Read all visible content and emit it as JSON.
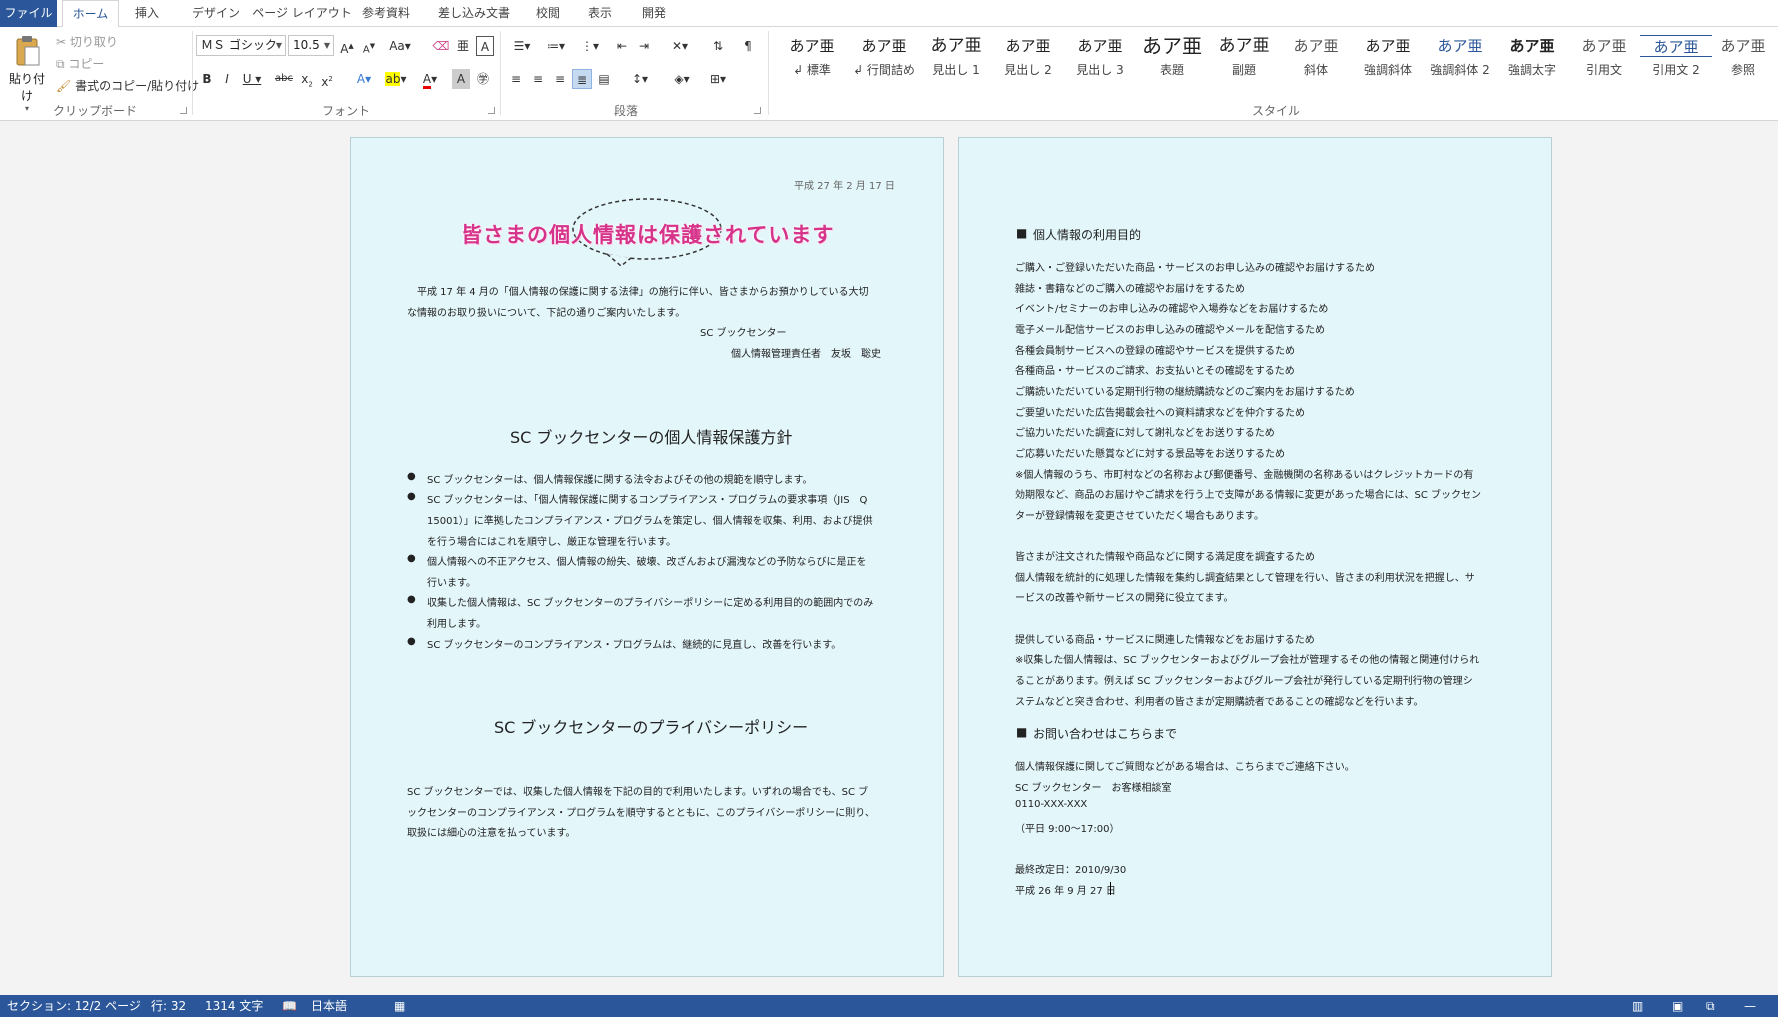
{
  "tabs": [
    "ファイル",
    "ホーム",
    "挿入",
    "デザイン",
    "ページ レイアウト",
    "参考資料",
    "差し込み文書",
    "校閲",
    "表示",
    "開発"
  ],
  "clipboard": {
    "paste": "貼り付け",
    "cut": "切り取り",
    "copy": "コピー",
    "format_painter": "書式のコピー/貼り付け",
    "label": "クリップボード"
  },
  "font": {
    "name": "ＭＳ ゴシック",
    "size": "10.5",
    "label": "フォント"
  },
  "paragraph": {
    "label": "段落"
  },
  "styles": {
    "label": "スタイル",
    "items": [
      {
        "sample": "あア亜",
        "name": "↲ 標準"
      },
      {
        "sample": "あア亜",
        "name": "↲ 行間詰め"
      },
      {
        "sample": "あア亜",
        "name": "見出し 1"
      },
      {
        "sample": "あア亜",
        "name": "見出し 2"
      },
      {
        "sample": "あア亜",
        "name": "見出し 3"
      },
      {
        "sample": "あア亜",
        "name": "表題"
      },
      {
        "sample": "あア亜",
        "name": "副題"
      },
      {
        "sample": "あア亜",
        "name": "斜体"
      },
      {
        "sample": "あア亜",
        "name": "強調斜体"
      },
      {
        "sample": "あア亜",
        "name": "強調斜体 2"
      },
      {
        "sample": "あア亜",
        "name": "強調太字"
      },
      {
        "sample": "あア亜",
        "name": "引用文"
      },
      {
        "sample": "あア亜",
        "name": "引用文 2"
      },
      {
        "sample": "あア亜",
        "name": "参照"
      }
    ]
  },
  "page1": {
    "date": "平成 27 年 2 月 17 日",
    "title": "皆さまの個人情報は保護されています",
    "intro": [
      "平成 17 年 4 月の「個人情報の保護に関する法律」の施行に伴い、皆さまからお預かりしている大切",
      "な情報のお取り扱いについて、下記の通りご案内いたします。"
    ],
    "org": "SC ブックセンター",
    "manager": "個人情報管理責任者　友坂　聡史",
    "policy_heading": "SC ブックセンターの個人情報保護方針",
    "bullets": [
      [
        "SC ブックセンターは、個人情報保護に関する法令およびその他の規範を順守します。"
      ],
      [
        "SC ブックセンターは、「個人情報保護に関するコンプライアンス・プログラムの要求事項（JIS　Q",
        "15001）」に準拠したコンプライアンス・プログラムを策定し、個人情報を収集、利用、および提供",
        "を行う場合にはこれを順守し、厳正な管理を行います。"
      ],
      [
        "個人情報への不正アクセス、個人情報の紛失、破壊、改ざんおよび漏洩などの予防ならびに是正を",
        "行います。"
      ],
      [
        "収集した個人情報は、SC ブックセンターのプライバシーポリシーに定める利用目的の範囲内でのみ",
        "利用します。"
      ],
      [
        "SC ブックセンターのコンプライアンス・プログラムは、継続的に見直し、改善を行います。"
      ]
    ],
    "privacy_heading": "SC ブックセンターのプライバシーポリシー",
    "privacy_body": [
      "SC ブックセンターでは、収集した個人情報を下記の目的で利用いたします。いずれの場合でも、SC ブ",
      "ックセンターのコンプライアンス・プログラムを順守するとともに、このプライバシーポリシーに則り、",
      "取扱には細心の注意を払っています。"
    ]
  },
  "page2": {
    "purpose_heading": "個人情報の利用目的",
    "purposes": [
      "ご購入・ご登録いただいた商品・サービスのお申し込みの確認やお届けするため",
      "雑誌・書籍などのご購入の確認やお届けをするため",
      "イベント/セミナーのお申し込みの確認や入場券などをお届けするため",
      "電子メール配信サービスのお申し込みの確認やメールを配信するため",
      "各種会員制サービスへの登録の確認やサービスを提供するため",
      "各種商品・サービスのご請求、お支払いとその確認をするため",
      "ご購読いただいている定期刊行物の継続購読などのご案内をお届けするため",
      "ご要望いただいた広告掲載会社への資料請求などを仲介するため",
      "ご協力いただいた調査に対して謝礼などをお送りするため",
      "ご応募いただいた懸賞などに対する景品等をお送りするため",
      "※個人情報のうち、市町村などの名称および郵便番号、金融機関の名称あるいはクレジットカードの有",
      "効期限など、商品のお届けやご請求を行う上で支障がある情報に変更があった場合には、SC ブックセン",
      "ターが登録情報を変更させていただく場合もあります。"
    ],
    "satisfaction": [
      "皆さまが注文された情報や商品などに関する満足度を調査するため",
      "個人情報を統計的に処理した情報を集約し調査結果として管理を行い、皆さまの利用状況を把握し、サ",
      "ービスの改善や新サービスの開発に役立てます。"
    ],
    "related": [
      "提供している商品・サービスに関連した情報などをお届けするため",
      "※収集した個人情報は、SC ブックセンターおよびグループ会社が管理するその他の情報と関連付けられ",
      "ることがあります。例えば SC ブックセンターおよびグループ会社が発行している定期刊行物の管理シ",
      "ステムなどと突き合わせ、利用者の皆さまが定期購読者であることの確認などを行います。"
    ],
    "contact_heading": "お問い合わせはこちらまで",
    "contact": [
      "個人情報保護に関してご質問などがある場合は、こちらまでご連絡下さい。",
      "SC ブックセンター　お客様相談室",
      "0110-XXX-XXX",
      "（平日 9:00～17:00）"
    ],
    "revised": "最終改定日：2010/9/30",
    "last_date": "平成 26 年 9 月 27 日"
  },
  "status": {
    "section": "セクション: 1",
    "page": "2/2 ページ",
    "line": "行: 32",
    "chars": "1314 文字",
    "lang": "日本語"
  },
  "colors": {
    "accent": "#2b579a",
    "page_bg": "#e3f6fa",
    "title": "#d6338a"
  }
}
